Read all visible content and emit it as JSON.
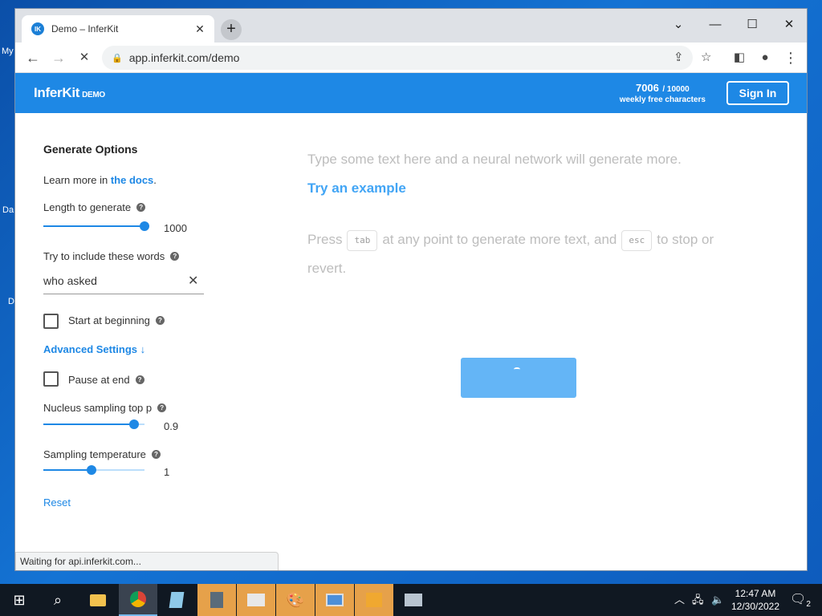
{
  "desktop": {
    "labels": [
      "My",
      "Da",
      "D"
    ]
  },
  "browser": {
    "tab_title": "Demo – InferKit",
    "tab_favicon": "IK",
    "tab_close": "✕",
    "new_tab": "+",
    "controls": {
      "chevron": "⌄",
      "minimize": "—",
      "maximize": "☐",
      "close": "✕"
    },
    "nav": {
      "back": "←",
      "forward": "→",
      "stop": "✕"
    },
    "url": "app.inferkit.com/demo",
    "status_text": "Waiting for api.inferkit.com..."
  },
  "header": {
    "brand": "InferKit",
    "brand_suffix": "DEMO",
    "chars_used": "7006",
    "chars_total": "/ 10000",
    "chars_caption": "weekly free characters",
    "signin_label": "Sign In"
  },
  "options": {
    "title": "Generate Options",
    "learn_prefix": "Learn more in ",
    "learn_link": "the docs",
    "learn_suffix": ".",
    "length_label": "Length to generate",
    "length_value": "1000",
    "length_fraction": 1.0,
    "include_label": "Try to include these words",
    "include_value": "who asked",
    "start_label": "Start at beginning",
    "advanced_label": "Advanced Settings ↓",
    "pause_label": "Pause at end",
    "topp_label": "Nucleus sampling top p",
    "topp_value": "0.9",
    "topp_fraction": 0.9,
    "temp_label": "Sampling temperature",
    "temp_value": "1",
    "temp_fraction": 0.48,
    "reset_label": "Reset",
    "help_glyph": "?"
  },
  "editor": {
    "placeholder": "Type some text here and a neural network will generate more.",
    "try_example": "Try an example",
    "press_prefix": "Press",
    "key_tab": "tab",
    "press_middle": "at any point to generate more text, and",
    "key_esc": "esc",
    "press_suffix": "to stop or revert."
  },
  "taskbar": {
    "time": "12:47 AM",
    "date": "12/30/2022",
    "notifications": "2",
    "colors": {
      "highlight": "#e6a14a",
      "accent": "#1e88e5"
    }
  }
}
